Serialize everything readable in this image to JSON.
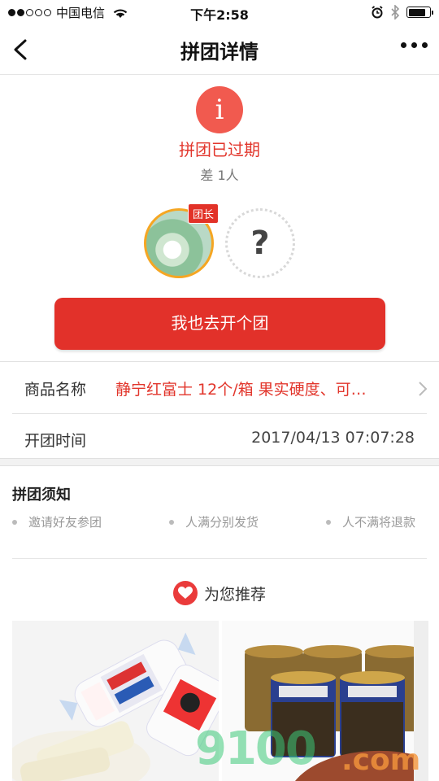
{
  "status_bar": {
    "carrier": "中国电信",
    "time": "下午2:58"
  },
  "nav": {
    "title": "拼团详情",
    "back_icon": "chevron-left-icon",
    "more_icon": "more-dots-icon"
  },
  "group_status": {
    "icon": "info-icon",
    "icon_glyph": "i",
    "title": "拼团已过期",
    "subtitle": "差 1人",
    "leader_tag": "团长",
    "empty_slot_glyph": "?",
    "cta_label": "我也去开个团"
  },
  "details": {
    "product_label": "商品名称",
    "product_value": "静宁红富士 12个/箱 果实硬度、可…",
    "start_label": "开团时间",
    "start_value": "2017/04/13 07:07:28"
  },
  "notice": {
    "title": "拼团须知",
    "items": [
      "邀请好友参团",
      "人满分别发货",
      "人不满将退款"
    ]
  },
  "recommend": {
    "title": "为您推荐",
    "icon": "heart-icon"
  },
  "colors": {
    "accent": "#e2312a",
    "leader_border": "#f5a623",
    "info_icon": "#f15a4f"
  }
}
